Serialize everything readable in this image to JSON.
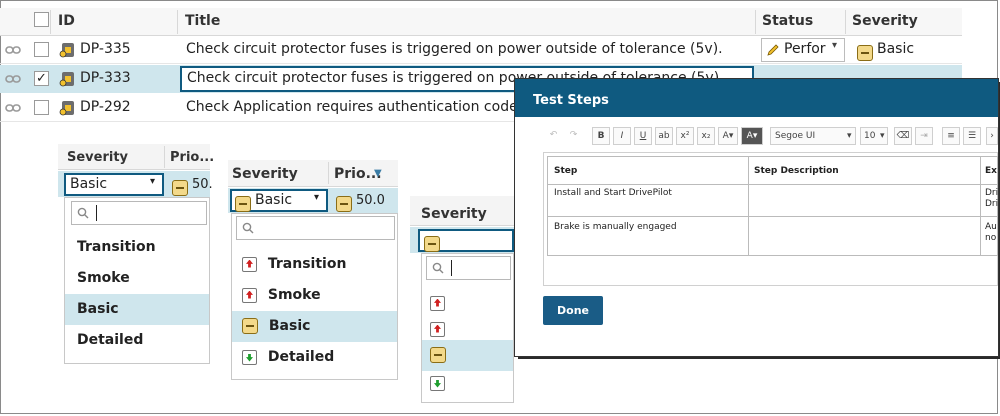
{
  "grid": {
    "columns": {
      "id": "ID",
      "title": "Title",
      "status": "Status",
      "severity": "Severity"
    },
    "rows": [
      {
        "id": "DP-335",
        "title": "Check  circuit protector fuses is triggered on power outside of tolerance (5v).",
        "status": "Perfor",
        "severity": "Basic",
        "checked": ""
      },
      {
        "id": "DP-333",
        "title": "Check  circuit protector fuses is triggered on power outside of tolerance (5v).",
        "status": "",
        "severity": "",
        "checked": "✓"
      },
      {
        "id": "DP-292",
        "title": "Check Application requires authentication code",
        "status": "",
        "severity": "",
        "checked": ""
      }
    ]
  },
  "dropdown1": {
    "col_severity": "Severity",
    "col_priority": "Prio...",
    "value": "Basic",
    "priority_value": "50.",
    "options": [
      "Transition",
      "Smoke",
      "Basic",
      "Detailed"
    ],
    "selected": "Basic"
  },
  "dropdown2": {
    "col_severity": "Severity",
    "col_priority": "Prio...",
    "value": "Basic",
    "priority_value": "50.0",
    "options": [
      "Transition",
      "Smoke",
      "Basic",
      "Detailed"
    ],
    "selected": "Basic"
  },
  "dropdown3": {
    "col_severity": "Severity"
  },
  "dialog": {
    "title": "Test Steps",
    "font_name": "Segoe UI",
    "font_size": "10",
    "table": {
      "headers": [
        "Step",
        "Step Description",
        "Ex"
      ],
      "rows": [
        {
          "step": "Install and Start DrivePilot",
          "desc": "",
          "exp1": "Dri",
          "exp2": "Dri"
        },
        {
          "step": "Brake is manually engaged",
          "desc": "",
          "exp1": "Au",
          "exp2": "no"
        }
      ]
    },
    "done_label": "Done"
  },
  "colors": {
    "selected_row": "#cfe6ed",
    "dialog_header": "#0f5a80",
    "done_button": "#1a5c86"
  }
}
